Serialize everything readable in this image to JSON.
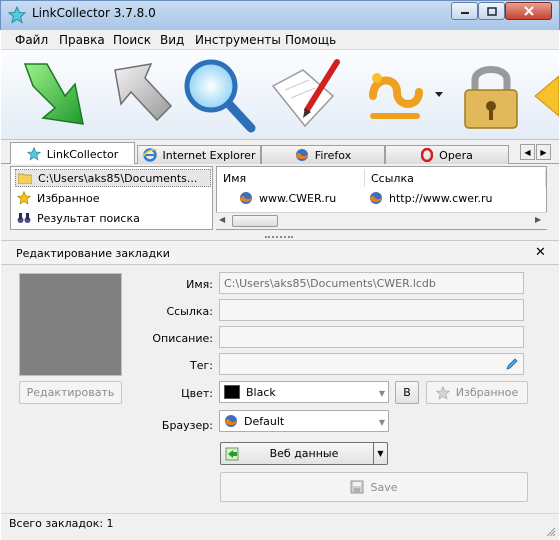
{
  "window": {
    "title": "LinkCollector 3.7.8.0"
  },
  "menu": [
    "Файл",
    "Правка",
    "Поиск",
    "Вид",
    "Инструменты",
    "Помощь"
  ],
  "toolbar": {
    "buttons": [
      {
        "name": "add-link-icon"
      },
      {
        "name": "go-icon"
      },
      {
        "name": "search-icon"
      },
      {
        "name": "edit-note-icon"
      },
      {
        "name": "link-icon"
      },
      {
        "name": "lock-icon"
      }
    ]
  },
  "tabs": [
    {
      "label": "LinkCollector",
      "icon": "star-icon",
      "active": true
    },
    {
      "label": "Internet Explorer",
      "icon": "ie-icon"
    },
    {
      "label": "Firefox",
      "icon": "firefox-icon"
    },
    {
      "label": "Opera",
      "icon": "opera-icon"
    }
  ],
  "tree": [
    {
      "label": "C:\\Users\\aks85\\Documents...",
      "icon": "folder-icon",
      "selected": true
    },
    {
      "label": "Избранное",
      "icon": "star-icon"
    },
    {
      "label": "Результат поиска",
      "icon": "binoculars-icon"
    }
  ],
  "list": {
    "columns": [
      "Имя",
      "Ссылка"
    ],
    "rows": [
      {
        "name": "www.CWER.ru",
        "link": "http://www.cwer.ru"
      }
    ]
  },
  "edit": {
    "title": "Редактирование закладки",
    "edit_button": "Редактировать",
    "labels": {
      "name": "Имя:",
      "link": "Ссылка:",
      "description": "Описание:",
      "tag": "Тег:",
      "color": "Цвет:",
      "browser": "Браузер:"
    },
    "values": {
      "name": "C:\\Users\\aks85\\Documents\\CWER.lcdb",
      "link": "",
      "description": "",
      "tag": "",
      "color": "Black",
      "browser": "Default"
    },
    "b_button": "B",
    "favorites_button": "Избранное",
    "web_data_button": "Веб данные",
    "save_button": "Save"
  },
  "status": {
    "text": "Всего закладок: 1"
  },
  "colors": {
    "accent": "#2f6fb3",
    "selection": "#e6e6e6"
  }
}
